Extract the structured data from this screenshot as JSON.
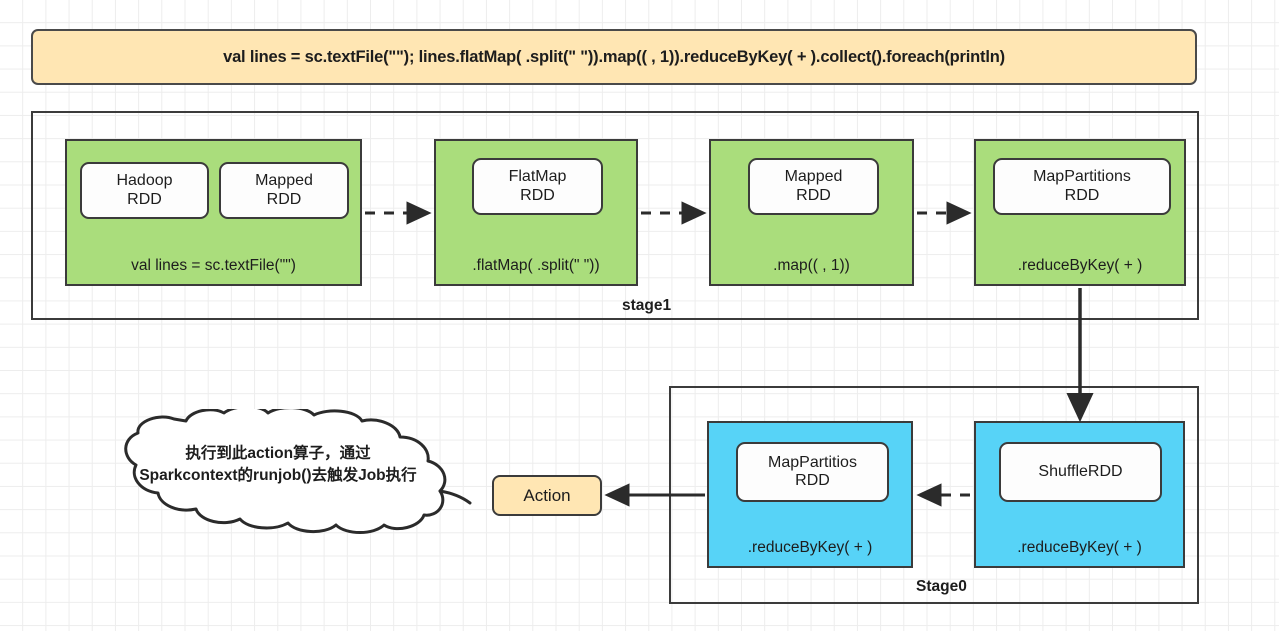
{
  "diagram": {
    "title_banner": {
      "code": "val lines = sc.textFile(\"\");  lines.flatMap( .split(\" \")).map(( , 1)).reduceByKey( + ).collect().foreach(println)",
      "fill_color": "#ffe6b3",
      "border_color": "#4a4a4a"
    },
    "stages": [
      {
        "id": "stage1",
        "label": "stage1",
        "fill_color": "#aadd7c",
        "groups": [
          {
            "id": "textfile",
            "caption": "val lines = sc.textFile(\"\")",
            "nodes": [
              "Hadoop\nRDD",
              "Mapped\nRDD"
            ]
          },
          {
            "id": "flatmap",
            "caption": ".flatMap( .split(\" \"))",
            "nodes": [
              "FlatMap\nRDD"
            ]
          },
          {
            "id": "map",
            "caption": ".map(( , 1))",
            "nodes": [
              "Mapped\nRDD"
            ]
          },
          {
            "id": "reducebykey1",
            "caption": ".reduceByKey( + )",
            "nodes": [
              "MapPartitions\nRDD"
            ]
          }
        ]
      },
      {
        "id": "stage0",
        "label": "Stage0",
        "fill_color": "#57d3f7",
        "groups": [
          {
            "id": "reducebykey2",
            "caption": ".reduceByKey( + )",
            "nodes": [
              "MapPartitios\nRDD"
            ]
          },
          {
            "id": "shuffle",
            "caption": ".reduceByKey( + )",
            "nodes": [
              "ShuffleRDD"
            ]
          }
        ]
      }
    ],
    "action": {
      "label": "Action",
      "fill_color": "#ffe6b3"
    },
    "cloud_note": {
      "text": "执行到此action算子，通过\nSparkcontext的runjob()去触发Job执行"
    },
    "colors": {
      "green": "#aadd7c",
      "blue": "#57d3f7",
      "orange": "#ffe6b3",
      "stroke": "#3b3b3b",
      "grid": "#ededed"
    }
  }
}
